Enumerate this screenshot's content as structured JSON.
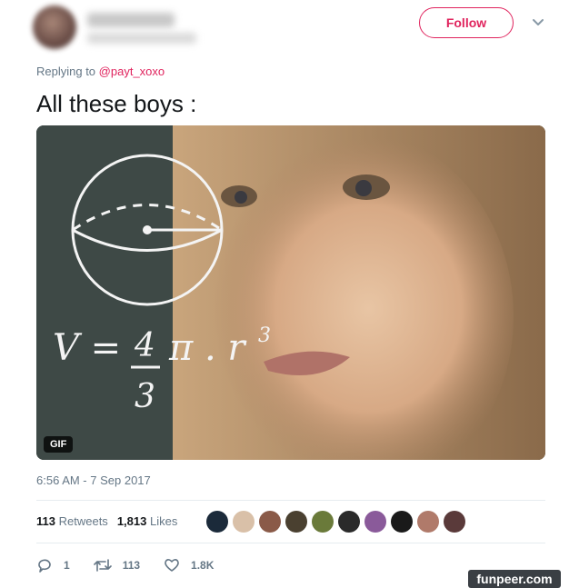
{
  "header": {
    "follow_label": "Follow"
  },
  "tweet": {
    "replying_prefix": "Replying to",
    "replying_to": "@payt_xoxo",
    "text": "All these boys :",
    "media_badge": "GIF",
    "formula": {
      "lhs": "V =",
      "numerator": "4",
      "denominator": "3",
      "pi_r": "π . r",
      "exponent": "3"
    },
    "timestamp": "6:56 AM - 7 Sep 2017"
  },
  "stats": {
    "retweets_count": "113",
    "retweets_label": "Retweets",
    "likes_count": "1,813",
    "likes_label": "Likes"
  },
  "likers": [
    {
      "color": "#1b2a3a"
    },
    {
      "color": "#d9c0a8"
    },
    {
      "color": "#8a5a48"
    },
    {
      "color": "#4a4030"
    },
    {
      "color": "#6a7a3a"
    },
    {
      "color": "#2a2a2a"
    },
    {
      "color": "#8a5a9a"
    },
    {
      "color": "#1a1a1a"
    },
    {
      "color": "#b07a6a"
    },
    {
      "color": "#5a3a3a"
    }
  ],
  "actions": {
    "reply_count": "1",
    "retweet_count": "113",
    "like_count": "1.8K"
  },
  "watermark": "funpeer.com"
}
